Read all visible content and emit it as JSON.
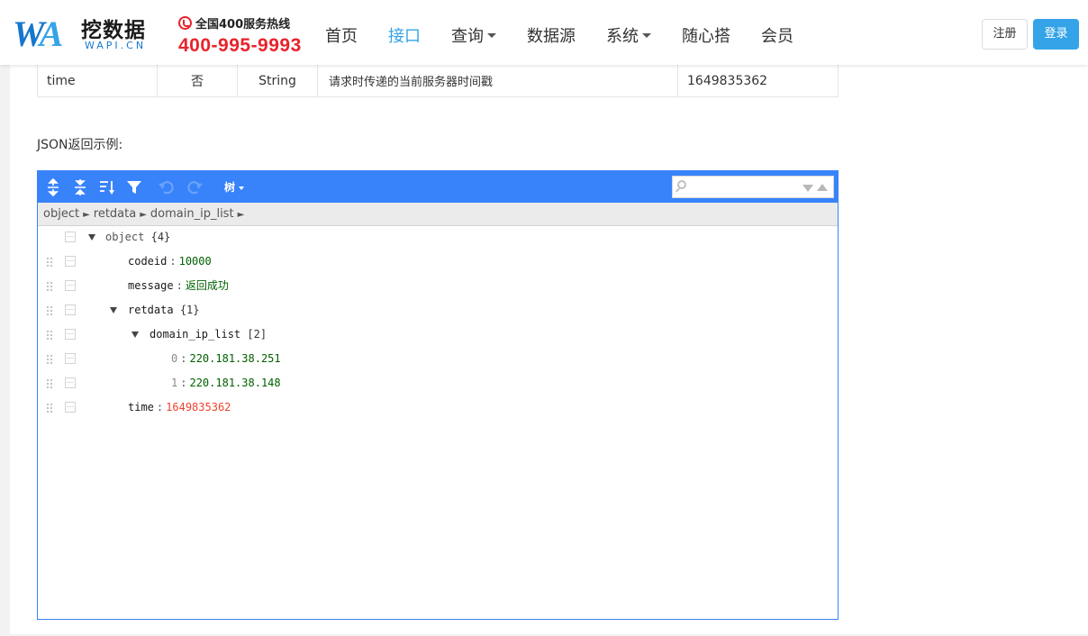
{
  "brand": {
    "logo_mark": "WA",
    "name_cn": "挖数据",
    "name_en": "WAPI.CN",
    "hotline_label": "全国400服务热线",
    "hotline_number": "400-995-9993"
  },
  "nav": {
    "items": [
      {
        "label": "首页",
        "dropdown": false,
        "active": false
      },
      {
        "label": "接口",
        "dropdown": false,
        "active": true
      },
      {
        "label": "查询",
        "dropdown": true,
        "active": false
      },
      {
        "label": "数据源",
        "dropdown": false,
        "active": false
      },
      {
        "label": "系统",
        "dropdown": true,
        "active": false
      },
      {
        "label": "随心搭",
        "dropdown": false,
        "active": false
      },
      {
        "label": "会员",
        "dropdown": false,
        "active": false
      }
    ],
    "register_label": "注册",
    "login_label": "登录"
  },
  "param_row": {
    "name": "time",
    "required": "否",
    "type": "String",
    "description": "请求时传递的当前服务器时间戳",
    "example": "1649835362"
  },
  "json_section_title": "JSON返回示例:",
  "editor": {
    "mode_label": "树",
    "search_value": "",
    "breadcrumb": [
      "object",
      "retdata",
      "domain_ip_list"
    ],
    "tree": {
      "root": {
        "label": "object",
        "count": "{4}"
      },
      "codeid": {
        "key": "codeid",
        "value": "10000"
      },
      "message": {
        "key": "message",
        "value": "返回成功"
      },
      "retdata": {
        "key": "retdata",
        "count": "{1}"
      },
      "domain_ip_list": {
        "key": "domain_ip_list",
        "count": "[2]"
      },
      "ip0": {
        "key": "0",
        "value": "220.181.38.251"
      },
      "ip1": {
        "key": "1",
        "value": "220.181.38.148"
      },
      "time": {
        "key": "time",
        "value": "1649835362"
      }
    }
  },
  "colors": {
    "brand_blue": "#1677cc",
    "accent_blue": "#35a3e8",
    "hotline_red": "#e8232b",
    "editor_blue": "#3883fa",
    "string_green": "#006000",
    "number_red": "#ee422e"
  }
}
